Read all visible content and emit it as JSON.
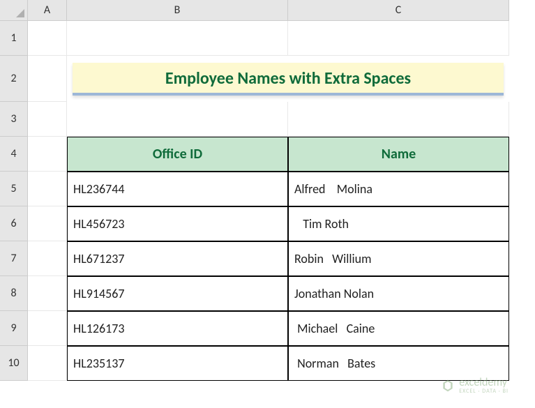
{
  "columns": [
    "A",
    "B",
    "C"
  ],
  "rows": [
    "1",
    "2",
    "3",
    "4",
    "5",
    "6",
    "7",
    "8",
    "9",
    "10"
  ],
  "title": "Employee Names with Extra Spaces",
  "table": {
    "headers": [
      "Office ID",
      "Name"
    ],
    "data": [
      {
        "id": "HL236744",
        "name": "Alfred    Molina"
      },
      {
        "id": "HL456723",
        "name": "   Tim Roth"
      },
      {
        "id": "HL671237",
        "name": "Robin   Willium"
      },
      {
        "id": "HL914567",
        "name": "Jonathan Nolan"
      },
      {
        "id": "HL126173",
        "name": " Michael   Caine"
      },
      {
        "id": "HL235137",
        "name": " Norman   Bates"
      }
    ]
  },
  "watermark": {
    "brand": "exceldemy",
    "tagline": "EXCEL · DATA · BI"
  },
  "chart_data": {
    "type": "table",
    "title": "Employee Names with Extra Spaces",
    "columns": [
      "Office ID",
      "Name"
    ],
    "rows": [
      [
        "HL236744",
        "Alfred    Molina"
      ],
      [
        "HL456723",
        "   Tim Roth"
      ],
      [
        "HL671237",
        "Robin   Willium"
      ],
      [
        "HL914567",
        "Jonathan Nolan"
      ],
      [
        "HL126173",
        " Michael   Caine"
      ],
      [
        "HL235137",
        " Norman   Bates"
      ]
    ]
  }
}
